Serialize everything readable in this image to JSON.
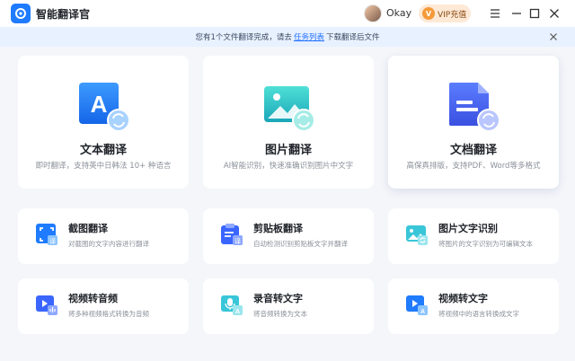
{
  "app": {
    "title": "智能翻译官"
  },
  "user": {
    "name": "Okay"
  },
  "vip": {
    "badge": "V",
    "label": "VIP充值"
  },
  "notice": {
    "prefix": "您有1个文件翻译完成，请去",
    "link": "任务列表",
    "suffix": "下载翻译后文件"
  },
  "big_cards": [
    {
      "title": "文本翻译",
      "desc": "即时翻译，支持英中日韩法 10+ 种语言",
      "icon": "text-translate-icon"
    },
    {
      "title": "图片翻译",
      "desc": "AI智能识别，快速准确识别图片中文字",
      "icon": "image-translate-icon"
    },
    {
      "title": "文档翻译",
      "desc": "高保真排版，支持PDF、Word等多格式",
      "icon": "document-translate-icon"
    }
  ],
  "small_cards": [
    {
      "title": "截图翻译",
      "desc": "对截图的文字内容进行翻译",
      "icon": "screenshot-translate-icon"
    },
    {
      "title": "剪贴板翻译",
      "desc": "自动检测识别剪贴板文字并翻译",
      "icon": "clipboard-translate-icon"
    },
    {
      "title": "图片文字识别",
      "desc": "将图片的文字识别为可编辑文本",
      "icon": "image-ocr-icon"
    },
    {
      "title": "视频转音频",
      "desc": "将多种视频格式转换为音频",
      "icon": "video-to-audio-icon"
    },
    {
      "title": "录音转文字",
      "desc": "将音频转换为文本",
      "icon": "audio-to-text-icon"
    },
    {
      "title": "视频转文字",
      "desc": "将视频中的语言转换成文字",
      "icon": "video-to-text-icon"
    }
  ],
  "colors": {
    "accent": "#1f7bff",
    "notice_bg": "#e8f1ff",
    "vip_bg": "#fde9d6"
  }
}
